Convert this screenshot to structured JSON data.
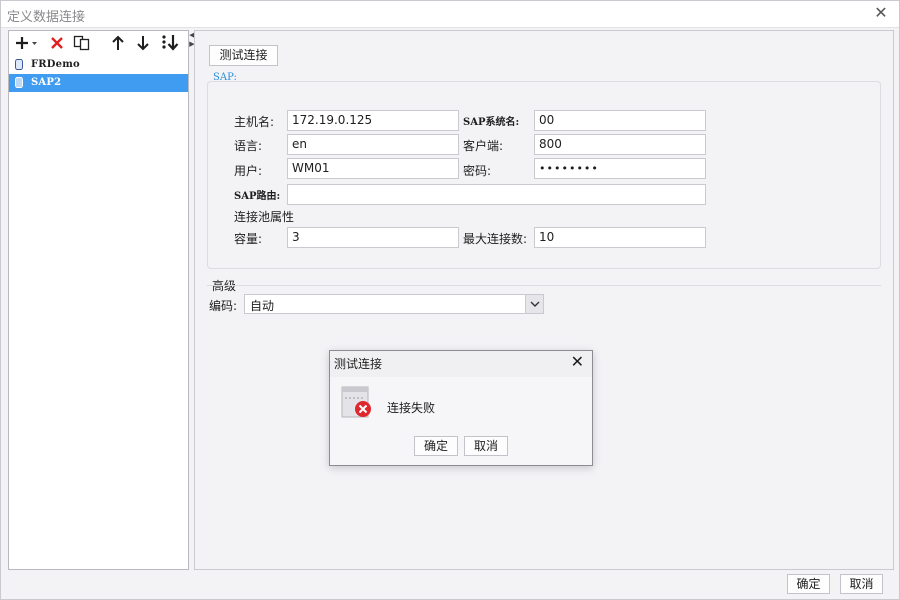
{
  "window": {
    "title": "定义数据连接"
  },
  "toolbar": {
    "buttons": [
      {
        "name": "add-icon",
        "label": ""
      },
      {
        "name": "delete-icon",
        "label": ""
      },
      {
        "name": "copy-icon",
        "label": ""
      },
      {
        "name": "move-up-icon",
        "label": ""
      },
      {
        "name": "move-down-icon",
        "label": ""
      },
      {
        "name": "sort-icon",
        "label": ""
      }
    ]
  },
  "tree": {
    "items": [
      {
        "label": "FRDemo",
        "selected": false
      },
      {
        "label": "SAP2",
        "selected": true
      }
    ]
  },
  "main": {
    "test_button": "测试连接",
    "sap_group_label": "SAP:",
    "fields": {
      "host_label": "主机名:",
      "host_value": "172.19.0.125",
      "sysname_label": "SAP系统名:",
      "sysname_value": "00",
      "lang_label": "语言:",
      "lang_value": "en",
      "client_label": "客户端:",
      "client_value": "800",
      "user_label": "用户:",
      "user_value": "WM01",
      "password_label": "密码:",
      "password_value": "••••••••",
      "route_label": "SAP路由:",
      "route_value": "",
      "pool_label": "连接池属性",
      "capacity_label": "容量:",
      "capacity_value": "3",
      "maxconn_label": "最大连接数:",
      "maxconn_value": "10"
    },
    "advanced_label": "高级",
    "encoding_label": "编码:",
    "encoding_value": "自动"
  },
  "dialog": {
    "title": "测试连接",
    "message": "连接失败",
    "ok_label": "确定",
    "cancel_label": "取消"
  },
  "footer": {
    "ok_label": "确定",
    "cancel_label": "取消"
  },
  "colors": {
    "accent": "#3f9cf0",
    "error": "#e0262d",
    "delete": "#e02020"
  }
}
